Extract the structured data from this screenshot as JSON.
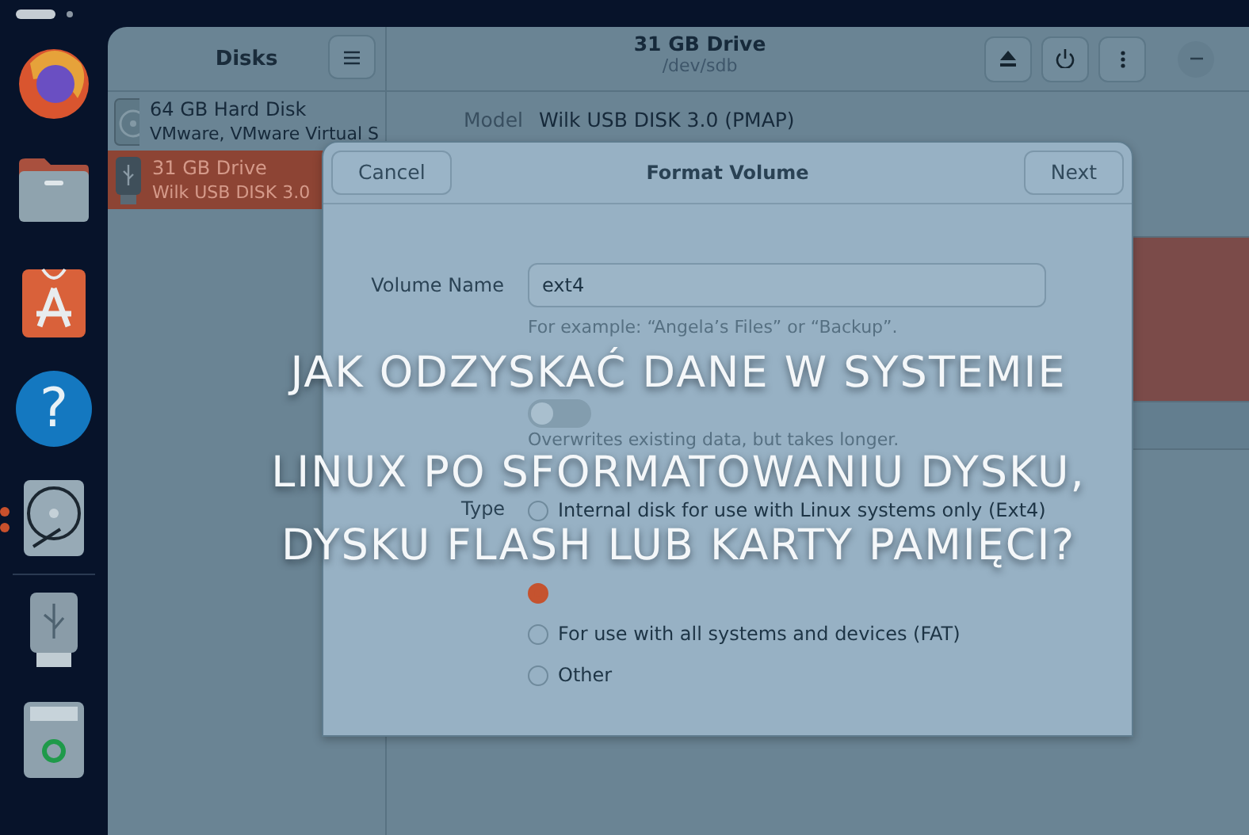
{
  "dock": {
    "items": [
      {
        "kind": "browser",
        "running": false
      },
      {
        "kind": "files",
        "running": false
      },
      {
        "kind": "store",
        "running": false
      },
      {
        "kind": "help",
        "glyph": "?",
        "running": false
      },
      {
        "kind": "disks",
        "running": true
      },
      {
        "kind": "separator"
      },
      {
        "kind": "usb",
        "running": false
      },
      {
        "kind": "trash",
        "running": false
      }
    ]
  },
  "window": {
    "sidebar_title": "Disks",
    "title": "31 GB Drive",
    "subtitle": "/dev/sdb"
  },
  "sidebar": {
    "items": [
      {
        "kind": "hdd",
        "name": "64 GB Hard Disk",
        "detail": "VMware, VMware Virtual S",
        "selected": false
      },
      {
        "kind": "usb",
        "name": "31 GB Drive",
        "detail": "Wilk USB DISK 3.0",
        "selected": true
      }
    ]
  },
  "drive_info": {
    "label": "Model",
    "value": "Wilk USB DISK 3.0 (PMAP)"
  },
  "dialog": {
    "title": "Format Volume",
    "cancel": "Cancel",
    "next": "Next",
    "volume_name": {
      "label": "Volume Name",
      "value": "ext4",
      "hint": "For example: “Angela’s Files” or “Backup”."
    },
    "erase": {
      "on": false,
      "hint": "Overwrites existing data, but takes longer."
    },
    "type_label": "Type",
    "type_options": [
      {
        "kind": "radio",
        "label": "Internal disk for use with Linux systems only (Ext4)",
        "selected": false
      },
      {
        "kind": "blank"
      },
      {
        "kind": "radio",
        "selected": true
      },
      {
        "kind": "radio",
        "label": "For use with all systems and devices (FAT)",
        "selected": false
      },
      {
        "kind": "radio",
        "label": "Other",
        "selected": false
      }
    ]
  },
  "headline": {
    "lines": [
      "JAK ODZYSKAĆ DANE W SYSTEMIE",
      "LINUX PO SFORMATOWANIU DYSKU,",
      "DYSKU FLASH LUB KARTY PAMIĘCI?"
    ]
  }
}
